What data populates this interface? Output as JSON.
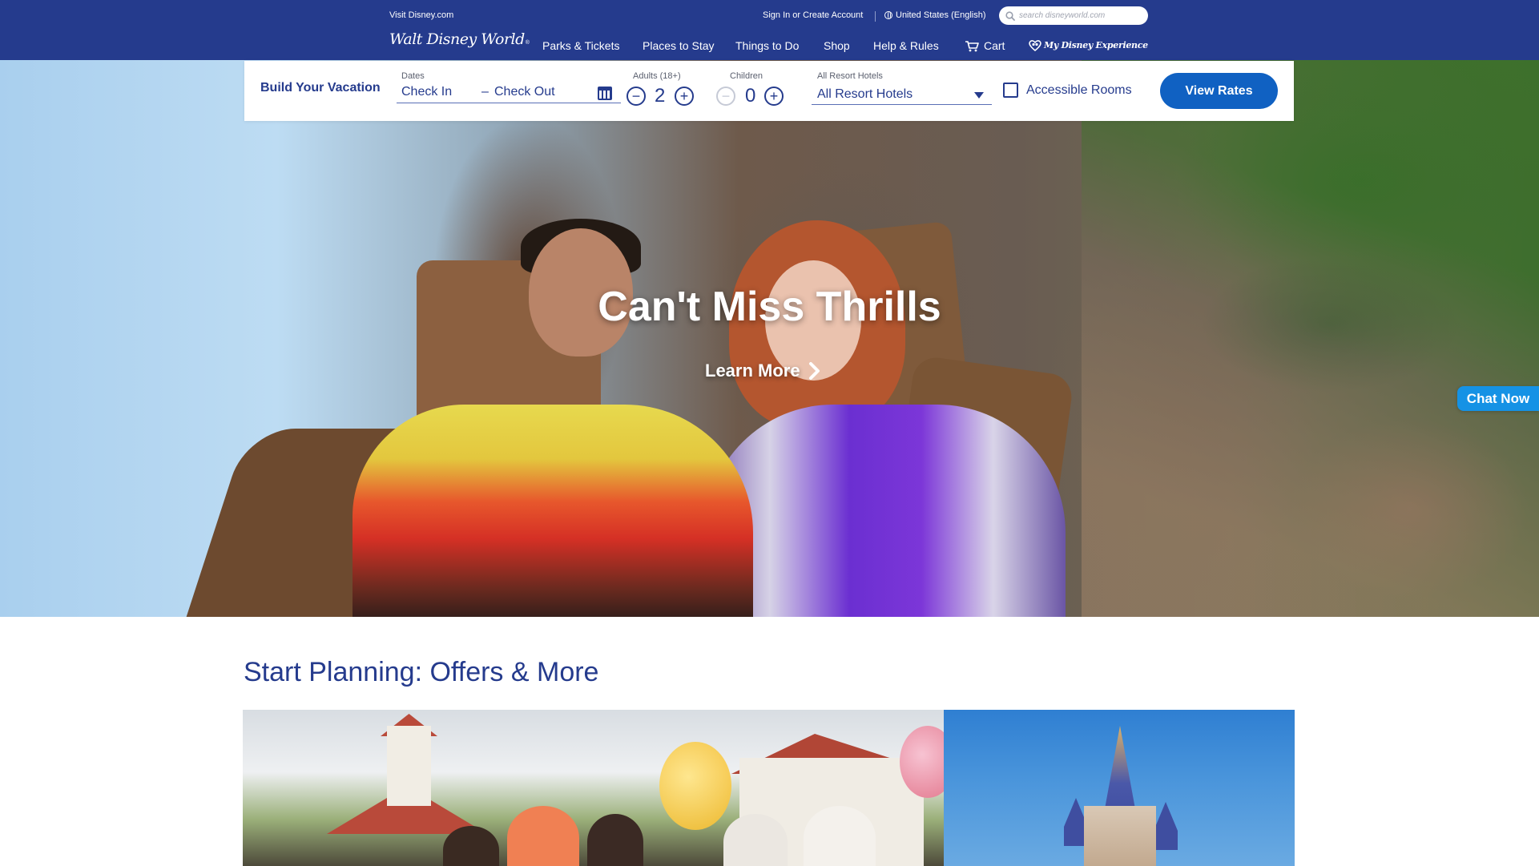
{
  "header": {
    "visit_link": "Visit Disney.com",
    "signin_link": "Sign In or Create Account",
    "locale": "United States (English)",
    "search_placeholder": "search disneyworld.com",
    "logo_text": "Walt Disney World",
    "logo_reg": "®",
    "nav": {
      "parks": "Parks & Tickets",
      "stay": "Places to Stay",
      "todo": "Things to Do",
      "shop": "Shop",
      "help": "Help & Rules",
      "cart": "Cart",
      "mde": "My Disney Experience"
    },
    "bg_color": "#253b8d"
  },
  "booking": {
    "title": "Build Your Vacation",
    "dates_label": "Dates",
    "check_in": "Check In",
    "dash": "–",
    "check_out": "Check Out",
    "adults_label": "Adults (18+)",
    "adults_count": "2",
    "children_label": "Children",
    "children_count": "0",
    "minus": "−",
    "plus": "+",
    "hotels_label": "All Resort Hotels",
    "hotels_value": "All Resort Hotels",
    "accessible_label": "Accessible Rooms",
    "accessible_checked": false,
    "view_rates": "View Rates",
    "button_color": "#1061c2"
  },
  "hero": {
    "title": "Can't Miss Thrills",
    "cta": "Learn More"
  },
  "chat": {
    "label": "Chat Now",
    "color": "#1592e5"
  },
  "planning": {
    "title": "Start Planning: Offers & More"
  },
  "icons": {
    "search": "search-icon",
    "globe": "globe-icon",
    "cart": "cart-icon",
    "mde": "mickey-heart-icon",
    "calendar": "calendar-icon",
    "caret": "caret-down-icon",
    "chevron": "chevron-right-icon"
  }
}
